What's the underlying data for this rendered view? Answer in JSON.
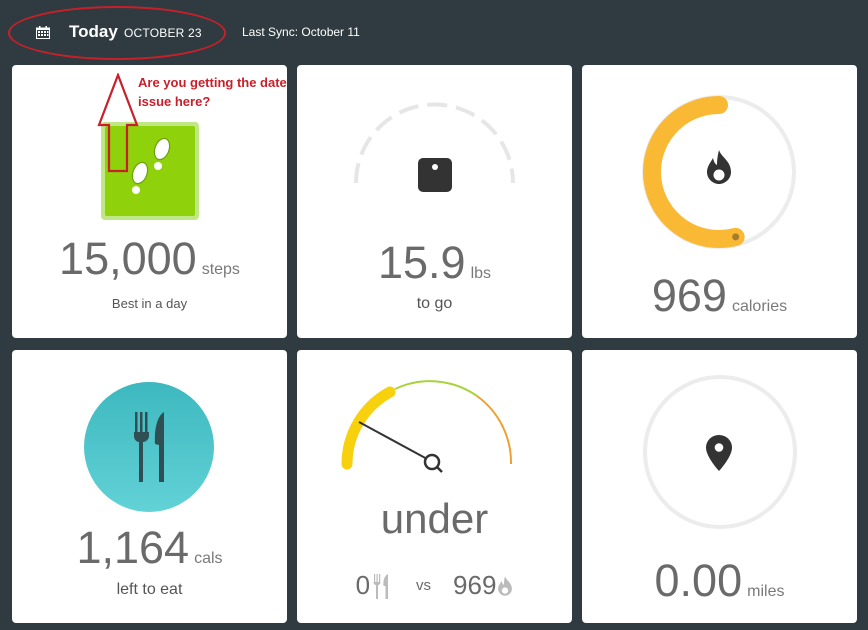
{
  "header": {
    "today_label": "Today",
    "date_label": "OCTOBER 23",
    "last_sync": "Last Sync: October 11"
  },
  "annotation": {
    "text": "Are you getting the date issue here?"
  },
  "tiles": {
    "steps": {
      "value": "15,000",
      "unit": "steps",
      "sub": "Best in a day"
    },
    "weight": {
      "value": "15.9",
      "unit": "lbs",
      "sub": "to go"
    },
    "calories": {
      "value": "969",
      "unit": "calories",
      "progress": 0.54,
      "color": "#f9b935"
    },
    "food": {
      "value": "1,164",
      "unit": "cals",
      "sub": "left to eat",
      "color": "#4cc3c9"
    },
    "budget": {
      "status": "under",
      "eaten": "0",
      "vs": "vs",
      "burned": "969"
    },
    "distance": {
      "value": "0.00",
      "unit": "miles"
    }
  },
  "icons": {
    "calendar": "calendar-icon",
    "footprints": "footprints-icon",
    "scale": "scale-icon",
    "flame": "flame-icon",
    "fork_knife": "fork-knife-icon",
    "location": "location-pin-icon"
  }
}
